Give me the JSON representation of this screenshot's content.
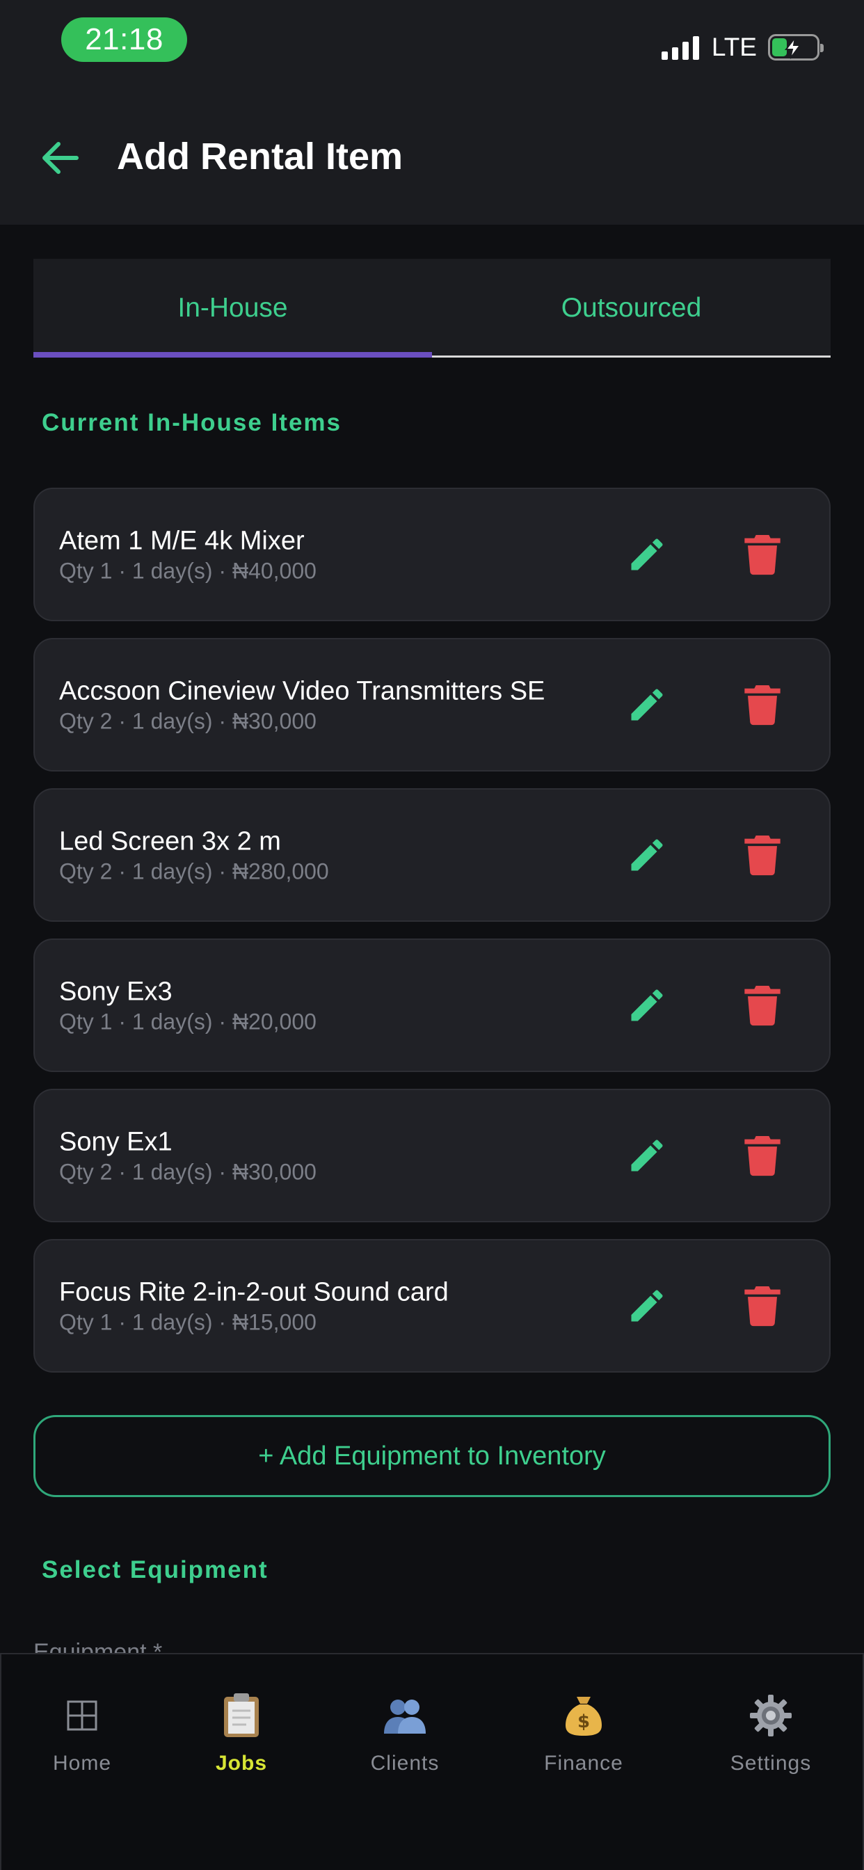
{
  "status_bar": {
    "time": "21:18",
    "network": "LTE"
  },
  "header": {
    "title": "Add Rental Item"
  },
  "tabs": [
    {
      "label": "In-House",
      "active": true
    },
    {
      "label": "Outsourced",
      "active": false
    }
  ],
  "sections": {
    "current_items": "Current In-House Items",
    "select_equipment": "Select Equipment"
  },
  "items": [
    {
      "name": "Atem 1 M/E 4k Mixer",
      "meta": "Qty 1 · 1 day(s) · ₦40,000"
    },
    {
      "name": "Accsoon Cineview Video Transmitters SE",
      "meta": "Qty 2 · 1 day(s) · ₦30,000"
    },
    {
      "name": "Led Screen 3x 2 m",
      "meta": "Qty 2 · 1 day(s) · ₦280,000"
    },
    {
      "name": "Sony Ex3",
      "meta": "Qty 1 · 1 day(s) · ₦20,000"
    },
    {
      "name": "Sony Ex1",
      "meta": "Qty 2 · 1 day(s) · ₦30,000"
    },
    {
      "name": "Focus Rite 2-in-2-out Sound card",
      "meta": "Qty 1 · 1 day(s) · ₦15,000"
    }
  ],
  "add_button": {
    "label": "+ Add Equipment to Inventory"
  },
  "equipment_field": {
    "label": "Equipment *"
  },
  "bottom_nav": [
    {
      "label": "Home",
      "icon": "home-grid-icon",
      "glyph": "⊞",
      "active": false
    },
    {
      "label": "Jobs",
      "icon": "clipboard-icon",
      "glyph": "📋",
      "active": true
    },
    {
      "label": "Clients",
      "icon": "people-icon",
      "glyph": "👥",
      "active": false
    },
    {
      "label": "Finance",
      "icon": "money-bag-icon",
      "glyph": "💰",
      "active": false
    },
    {
      "label": "Settings",
      "icon": "gear-icon",
      "glyph": "⚙️",
      "active": false
    }
  ],
  "colors": {
    "accent": "#3ecf8e",
    "delete": "#e5484d",
    "tab_indicator": "#6b4fc0",
    "nav_active": "#d7e535"
  }
}
